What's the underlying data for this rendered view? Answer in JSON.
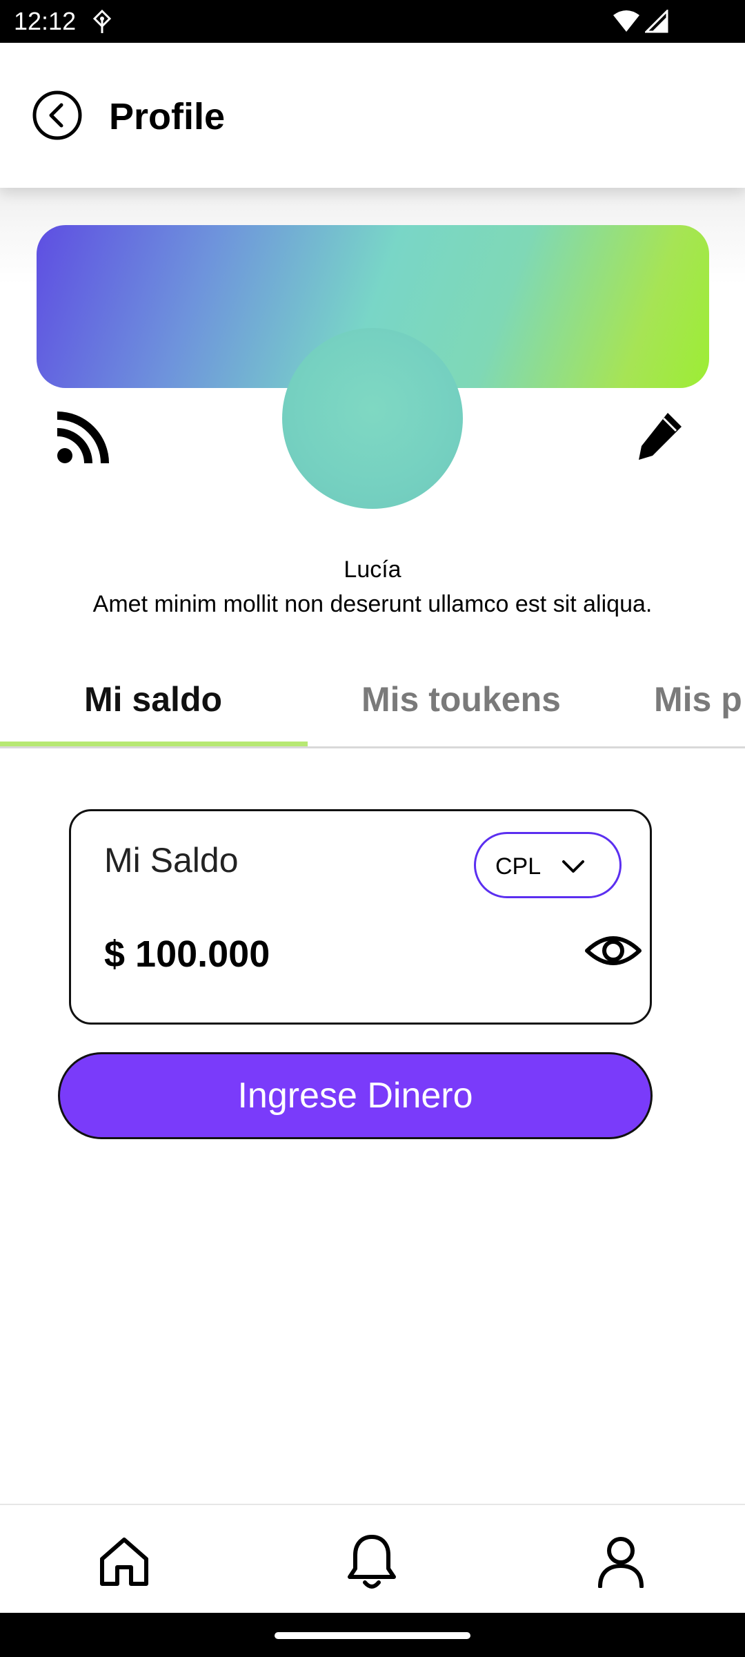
{
  "status_bar": {
    "time": "12:12"
  },
  "header": {
    "title": "Profile",
    "back_icon": "chevron-left-circle-icon"
  },
  "profile": {
    "name": "Lucía",
    "bio": "Amet minim mollit non deserunt ullamco est sit aliqua.",
    "left_icon": "rss-feed-icon",
    "right_icon": "pencil-edit-icon"
  },
  "tabs": [
    {
      "label": "Mi saldo",
      "active": true
    },
    {
      "label": "Mis toukens",
      "active": false
    },
    {
      "label": "Mis p",
      "active": false
    }
  ],
  "balance": {
    "title": "Mi Saldo",
    "currency": "CPL",
    "amount": "$ 100.000"
  },
  "actions": {
    "deposit_label": "Ingrese Dinero"
  },
  "bottom_nav": {
    "items": [
      "home-icon",
      "bell-icon",
      "user-icon"
    ]
  },
  "colors": {
    "accent_purple": "#7a3bfa",
    "select_border": "#5b2ff0",
    "tab_indicator": "#b7e873"
  }
}
